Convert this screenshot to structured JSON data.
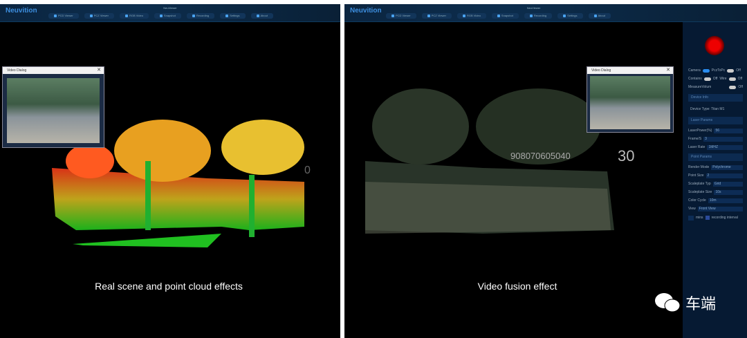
{
  "app": {
    "logo": "Neuvition",
    "title": "NeuViewer"
  },
  "nav": [
    {
      "label": "PCD Viewer"
    },
    {
      "label": "PCZ Viewer"
    },
    {
      "label": "RGB Video"
    },
    {
      "label": "Snapshot"
    },
    {
      "label": "Recording"
    },
    {
      "label": "Settings"
    },
    {
      "label": "About"
    }
  ],
  "left": {
    "dialog_title": "Video Dialog",
    "scale_label": "0",
    "caption": "Real scene and point cloud effects"
  },
  "right": {
    "dialog_title": "Video Dialog",
    "scale_label": "908070605040",
    "scale_big": "30",
    "caption": "Video fusion effect"
  },
  "panel": {
    "camera": "Camera",
    "pcz": "PczToPc",
    "pcz_state": "Off",
    "contains": "Contains",
    "contains_state": "Off",
    "wire": "Wire",
    "wire_state": "Off",
    "measure": "MeasureVolum",
    "measure_state": "Off",
    "device_info": "Device Info",
    "device_type": "Device Type: Titan M1",
    "laser_params": "Laser Params",
    "laser_power_label": "LaserPower(%)",
    "laser_power": "56",
    "frame_label": "Frame/S",
    "frame": "3",
    "laser_rate_label": "Laser Rate",
    "laser_rate": "1MHZ",
    "point_params": "Point Params",
    "render_label": "Render Mode",
    "render": "Polychrome",
    "point_size_label": "Point Size",
    "point_size": "2",
    "scale_type_label": "Scaleplate Typ",
    "scale_type": "Grid",
    "scale_size_label": "Scaleplate Size",
    "scale_size": "10s",
    "color_cycle_label": "Color Cycle",
    "color_cycle": "10m",
    "view_label": "View",
    "view": "Front View",
    "mins": "mins",
    "rec_interval": "recording interval"
  },
  "watermark": "车端"
}
